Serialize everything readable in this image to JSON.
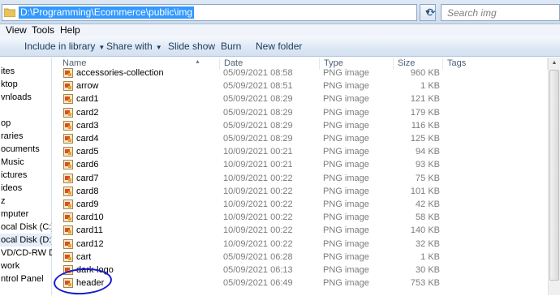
{
  "address": {
    "path": "D:\\Programming\\Ecommerce\\public\\img",
    "search_placeholder": "Search img"
  },
  "menu": [
    "View",
    "Tools",
    "Help"
  ],
  "toolbar": {
    "include_label": "Include in library",
    "share_label": "Share with",
    "slideshow_label": "Slide show",
    "burn_label": "Burn",
    "newfolder_label": "New folder"
  },
  "nav": [
    {
      "label": "ites",
      "selected": false
    },
    {
      "label": "ktop",
      "selected": false
    },
    {
      "label": "vnloads",
      "selected": false
    },
    {
      "label": "",
      "selected": false
    },
    {
      "label": "op",
      "selected": false
    },
    {
      "label": "raries",
      "selected": false
    },
    {
      "label": "ocuments",
      "selected": false
    },
    {
      "label": "Music",
      "selected": false
    },
    {
      "label": "ictures",
      "selected": false
    },
    {
      "label": "ideos",
      "selected": false
    },
    {
      "label": "z",
      "selected": false
    },
    {
      "label": "mputer",
      "selected": false
    },
    {
      "label": "ocal Disk (C:)",
      "selected": false
    },
    {
      "label": "ocal Disk (D:)",
      "selected": true
    },
    {
      "label": "VD/CD-RW Driv",
      "selected": false
    },
    {
      "label": "work",
      "selected": false
    },
    {
      "label": "ntrol Panel",
      "selected": false
    }
  ],
  "columns": {
    "name": "Name",
    "date": "Date",
    "type": "Type",
    "size": "Size",
    "tags": "Tags"
  },
  "files": [
    {
      "name": "accessories-collection",
      "date": "05/09/2021 08:58",
      "type": "PNG image",
      "size": "960 KB"
    },
    {
      "name": "arrow",
      "date": "05/09/2021 08:51",
      "type": "PNG image",
      "size": "1 KB"
    },
    {
      "name": "card1",
      "date": "05/09/2021 08:29",
      "type": "PNG image",
      "size": "121 KB"
    },
    {
      "name": "card2",
      "date": "05/09/2021 08:29",
      "type": "PNG image",
      "size": "179 KB"
    },
    {
      "name": "card3",
      "date": "05/09/2021 08:29",
      "type": "PNG image",
      "size": "116 KB"
    },
    {
      "name": "card4",
      "date": "05/09/2021 08:29",
      "type": "PNG image",
      "size": "125 KB"
    },
    {
      "name": "card5",
      "date": "10/09/2021 00:21",
      "type": "PNG image",
      "size": "94 KB"
    },
    {
      "name": "card6",
      "date": "10/09/2021 00:21",
      "type": "PNG image",
      "size": "93 KB"
    },
    {
      "name": "card7",
      "date": "10/09/2021 00:22",
      "type": "PNG image",
      "size": "75 KB"
    },
    {
      "name": "card8",
      "date": "10/09/2021 00:22",
      "type": "PNG image",
      "size": "101 KB"
    },
    {
      "name": "card9",
      "date": "10/09/2021 00:22",
      "type": "PNG image",
      "size": "42 KB"
    },
    {
      "name": "card10",
      "date": "10/09/2021 00:22",
      "type": "PNG image",
      "size": "58 KB"
    },
    {
      "name": "card11",
      "date": "10/09/2021 00:22",
      "type": "PNG image",
      "size": "140 KB"
    },
    {
      "name": "card12",
      "date": "10/09/2021 00:22",
      "type": "PNG image",
      "size": "32 KB"
    },
    {
      "name": "cart",
      "date": "05/09/2021 06:28",
      "type": "PNG image",
      "size": "1 KB"
    },
    {
      "name": "dark-logo",
      "date": "05/09/2021 06:13",
      "type": "PNG image",
      "size": "30 KB"
    },
    {
      "name": "header",
      "date": "05/09/2021 06:49",
      "type": "PNG image",
      "size": "753 KB"
    }
  ],
  "icons": {
    "folder": "folder-icon",
    "file": "png-file-icon",
    "refresh": "refresh-icon"
  },
  "colors": {
    "selection": "#3399ff",
    "annotation": "#1a1acd"
  }
}
